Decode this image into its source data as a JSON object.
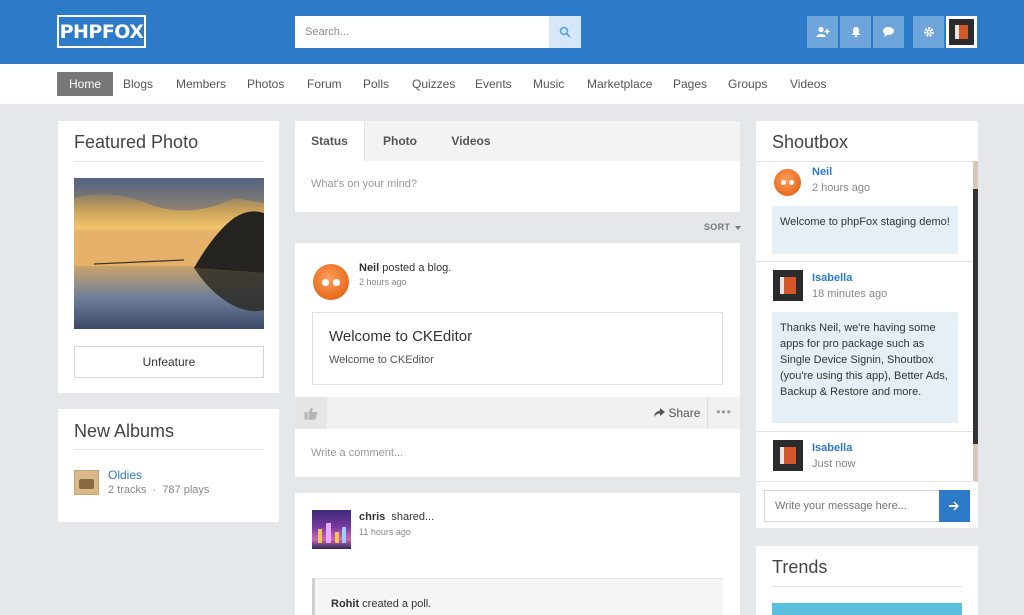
{
  "header": {
    "logo_text": "PHPFOX",
    "search_placeholder": "Search...",
    "colors": {
      "primary": "#2d7ac9",
      "button": "#6ea6dc"
    },
    "icons": [
      "add-friend-icon",
      "bell-icon",
      "chat-icon",
      "gear-icon"
    ]
  },
  "nav": {
    "items": [
      "Home",
      "Blogs",
      "Members",
      "Photos",
      "Forum",
      "Polls",
      "Quizzes",
      "Events",
      "Music",
      "Marketplace",
      "Pages",
      "Groups",
      "Videos"
    ],
    "active": "Home"
  },
  "featured_photo": {
    "title": "Featured Photo",
    "button_label": "Unfeature"
  },
  "new_albums": {
    "title": "New Albums",
    "album_name": "Oldies",
    "tracks": "2 tracks",
    "separator": "·",
    "plays": "787 plays"
  },
  "composer": {
    "tabs": [
      "Status",
      "Photo",
      "Videos"
    ],
    "placeholder": "What's on your mind?",
    "sort_label": "SORT"
  },
  "post1": {
    "author": "Neil",
    "action": "posted a blog.",
    "time": "2 hours ago",
    "blog_title": "Welcome to CKEditor",
    "blog_body": "Welcome to CKEditor",
    "share_label": "Share",
    "comment_placeholder": "Write a comment..."
  },
  "post2": {
    "author": "chris",
    "action": "shared...",
    "time": "11 hours ago",
    "shared_author": "Rohit",
    "shared_action": "created a poll."
  },
  "shoutbox": {
    "title": "Shoutbox",
    "messages": [
      {
        "author": "Neil",
        "time": "2 hours ago",
        "text": "Welcome to phpFox staging demo!"
      },
      {
        "author": "Isabella",
        "time": "18 minutes ago",
        "text": "Thanks Neil, we're having some apps for pro package such as Single Device Signin, Shoutbox (you're using this app), Better Ads, Backup & Restore and more."
      },
      {
        "author": "Isabella",
        "time": "Just now",
        "text": ""
      }
    ],
    "input_placeholder": "Write your message here..."
  },
  "trends": {
    "title": "Trends"
  }
}
